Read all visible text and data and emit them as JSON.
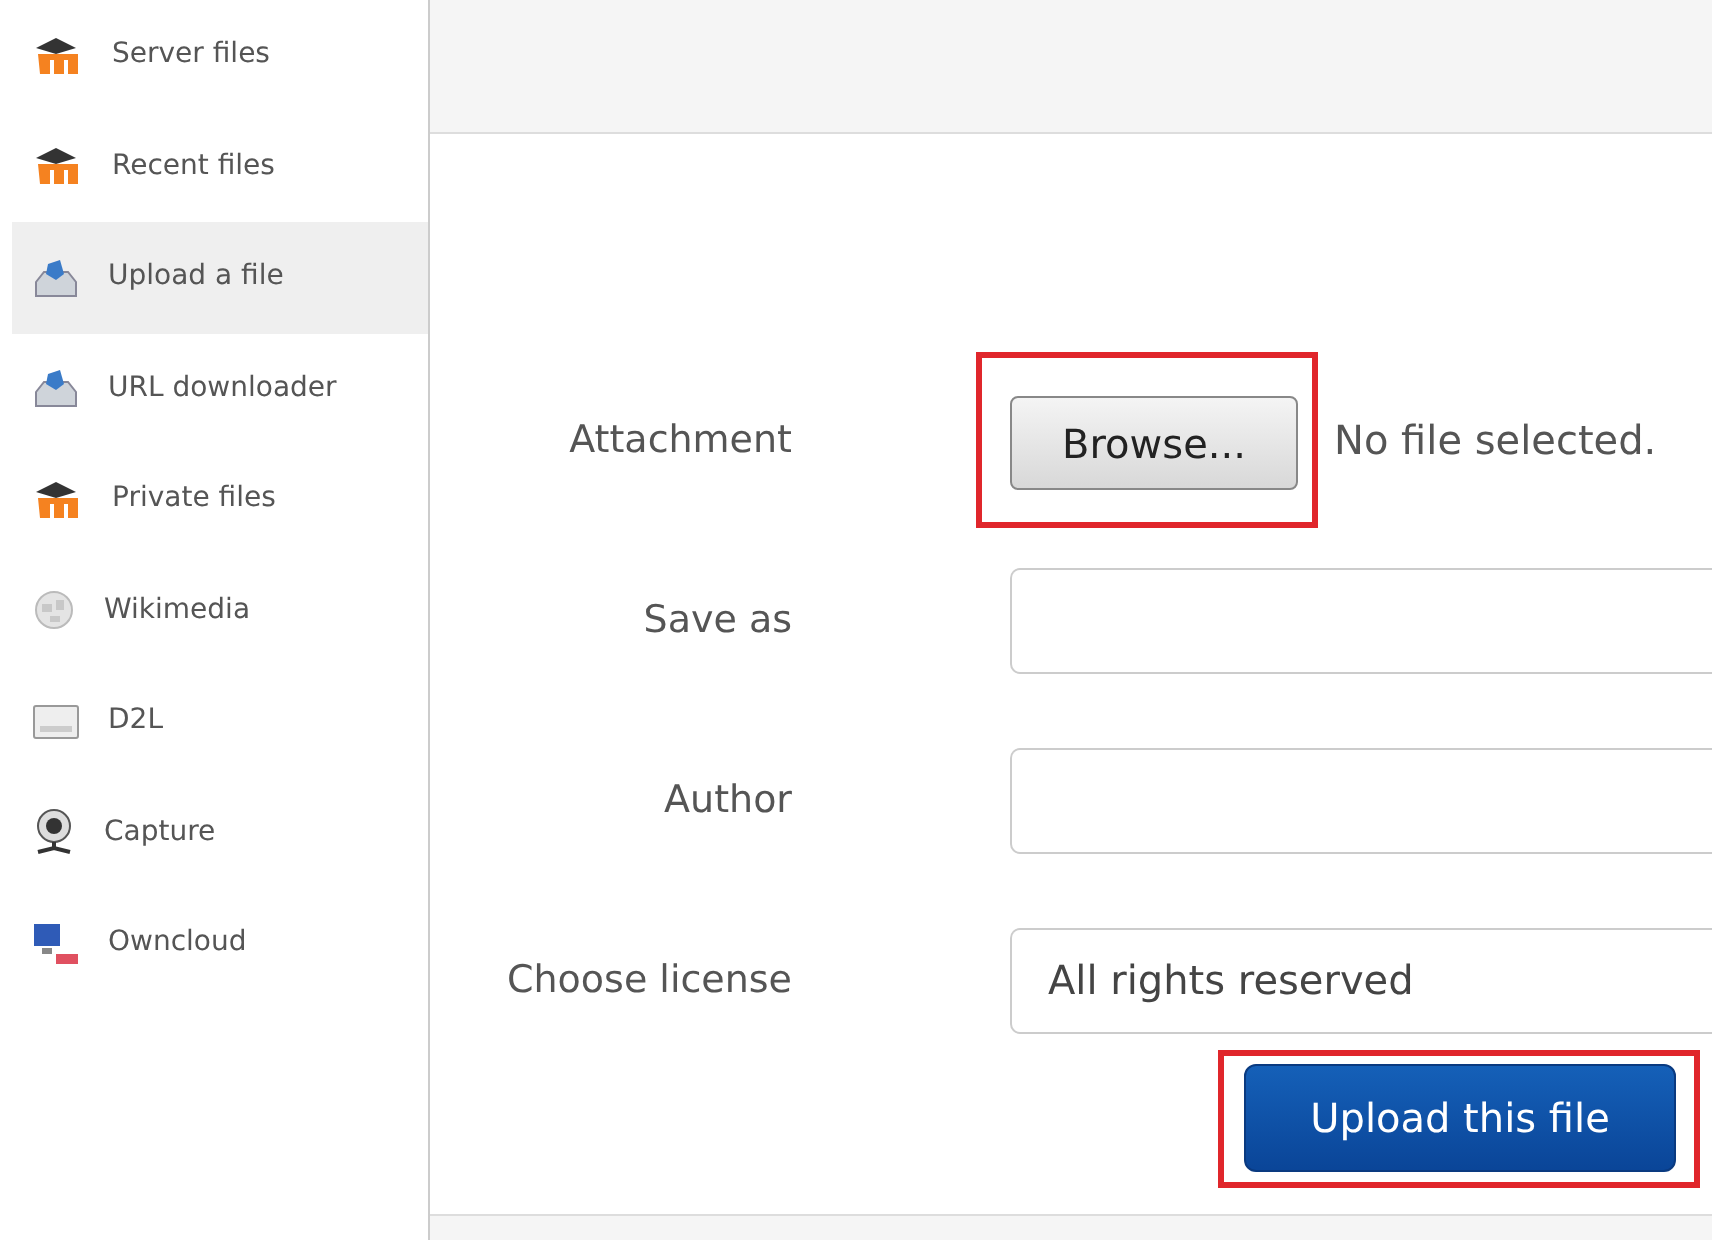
{
  "sidebar": {
    "items": [
      {
        "label": "Server files",
        "kind": "moodle",
        "selected": false
      },
      {
        "label": "Recent files",
        "kind": "moodle",
        "selected": false
      },
      {
        "label": "Upload a file",
        "kind": "upload",
        "selected": true
      },
      {
        "label": "URL downloader",
        "kind": "upload",
        "selected": false
      },
      {
        "label": "Private files",
        "kind": "moodle",
        "selected": false
      },
      {
        "label": "Wikimedia",
        "kind": "globe",
        "selected": false
      },
      {
        "label": "D2L",
        "kind": "screen",
        "selected": false
      },
      {
        "label": "Capture",
        "kind": "webcam",
        "selected": false
      },
      {
        "label": "Owncloud",
        "kind": "computer",
        "selected": false
      }
    ]
  },
  "form": {
    "fields": [
      {
        "kind": "file",
        "label": "Attachment",
        "button": "Browse...",
        "status": "No file selected.",
        "highlighted": true
      },
      {
        "kind": "text",
        "label": "Save as"
      },
      {
        "kind": "text",
        "label": "Author"
      },
      {
        "kind": "select",
        "label": "Choose license",
        "value": "All rights reserved"
      }
    ],
    "submit": {
      "label": "Upload this file",
      "highlighted": true
    }
  }
}
